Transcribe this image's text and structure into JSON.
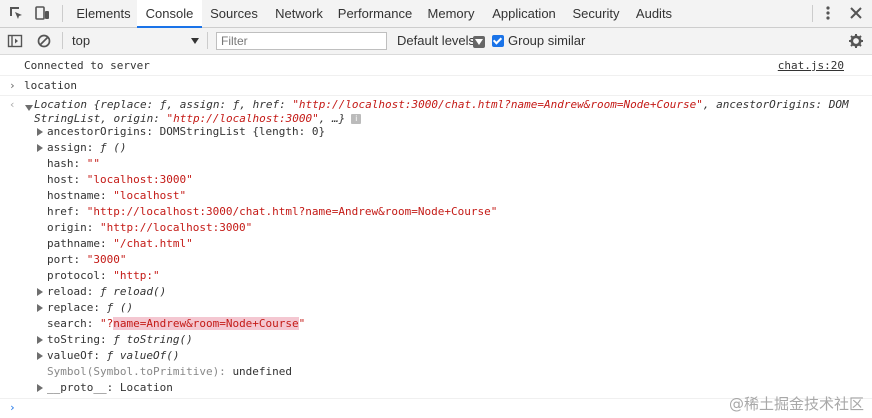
{
  "tabs": [
    "Elements",
    "Console",
    "Sources",
    "Network",
    "Performance",
    "Memory",
    "Application",
    "Security",
    "Audits"
  ],
  "active_tab": "Console",
  "toolbar": {
    "context": "top",
    "filter_placeholder": "Filter",
    "levels": "Default levels",
    "group_similar": "Group similar"
  },
  "console": {
    "msg1": "Connected to server",
    "msg1_link": "chat.js:20",
    "input": "location",
    "summary1_pre": "Location {replace: ",
    "summary1_f1": "ƒ",
    "summary1_mid1": ", assign: ",
    "summary1_f2": "ƒ",
    "summary1_mid2": ", href: ",
    "summary1_href": "\"http://localhost:3000/chat.html?name=Andrew&room=Node+Course\"",
    "summary1_post": ", ancestorOrigins: DOM",
    "summary2_pre": "StringList, origin: ",
    "summary2_origin": "\"http://localhost:3000\"",
    "summary2_post": ", …}",
    "info_glyph": "i",
    "props": {
      "ancestorOrigins_key": "ancestorOrigins:",
      "ancestorOrigins_type": "DOMStringList",
      "ancestorOrigins_val": "{length: 0}",
      "assign_key": "assign:",
      "assign_val": "ƒ ()",
      "hash_key": "hash:",
      "hash_val": "\"\"",
      "host_key": "host:",
      "host_val": "\"localhost:3000\"",
      "hostname_key": "hostname:",
      "hostname_val": "\"localhost\"",
      "href_key": "href:",
      "href_val": "\"http://localhost:3000/chat.html?name=Andrew&room=Node+Course\"",
      "origin_key": "origin:",
      "origin_val": "\"http://localhost:3000\"",
      "pathname_key": "pathname:",
      "pathname_val": "\"/chat.html\"",
      "port_key": "port:",
      "port_val": "\"3000\"",
      "protocol_key": "protocol:",
      "protocol_val": "\"http:\"",
      "reload_key": "reload:",
      "reload_val": "ƒ reload()",
      "replace_key": "replace:",
      "replace_val": "ƒ ()",
      "search_key": "search:",
      "search_q1": "\"?",
      "search_hl": "name=Andrew&room=Node+Course",
      "search_q2": "\"",
      "toString_key": "toString:",
      "toString_val": "ƒ toString()",
      "valueOf_key": "valueOf:",
      "valueOf_val": "ƒ valueOf()",
      "symbol_key": "Symbol(Symbol.toPrimitive):",
      "symbol_val": "undefined",
      "proto_key": "__proto__:",
      "proto_val": "Location"
    }
  },
  "watermark": "@稀土掘金技术社区"
}
